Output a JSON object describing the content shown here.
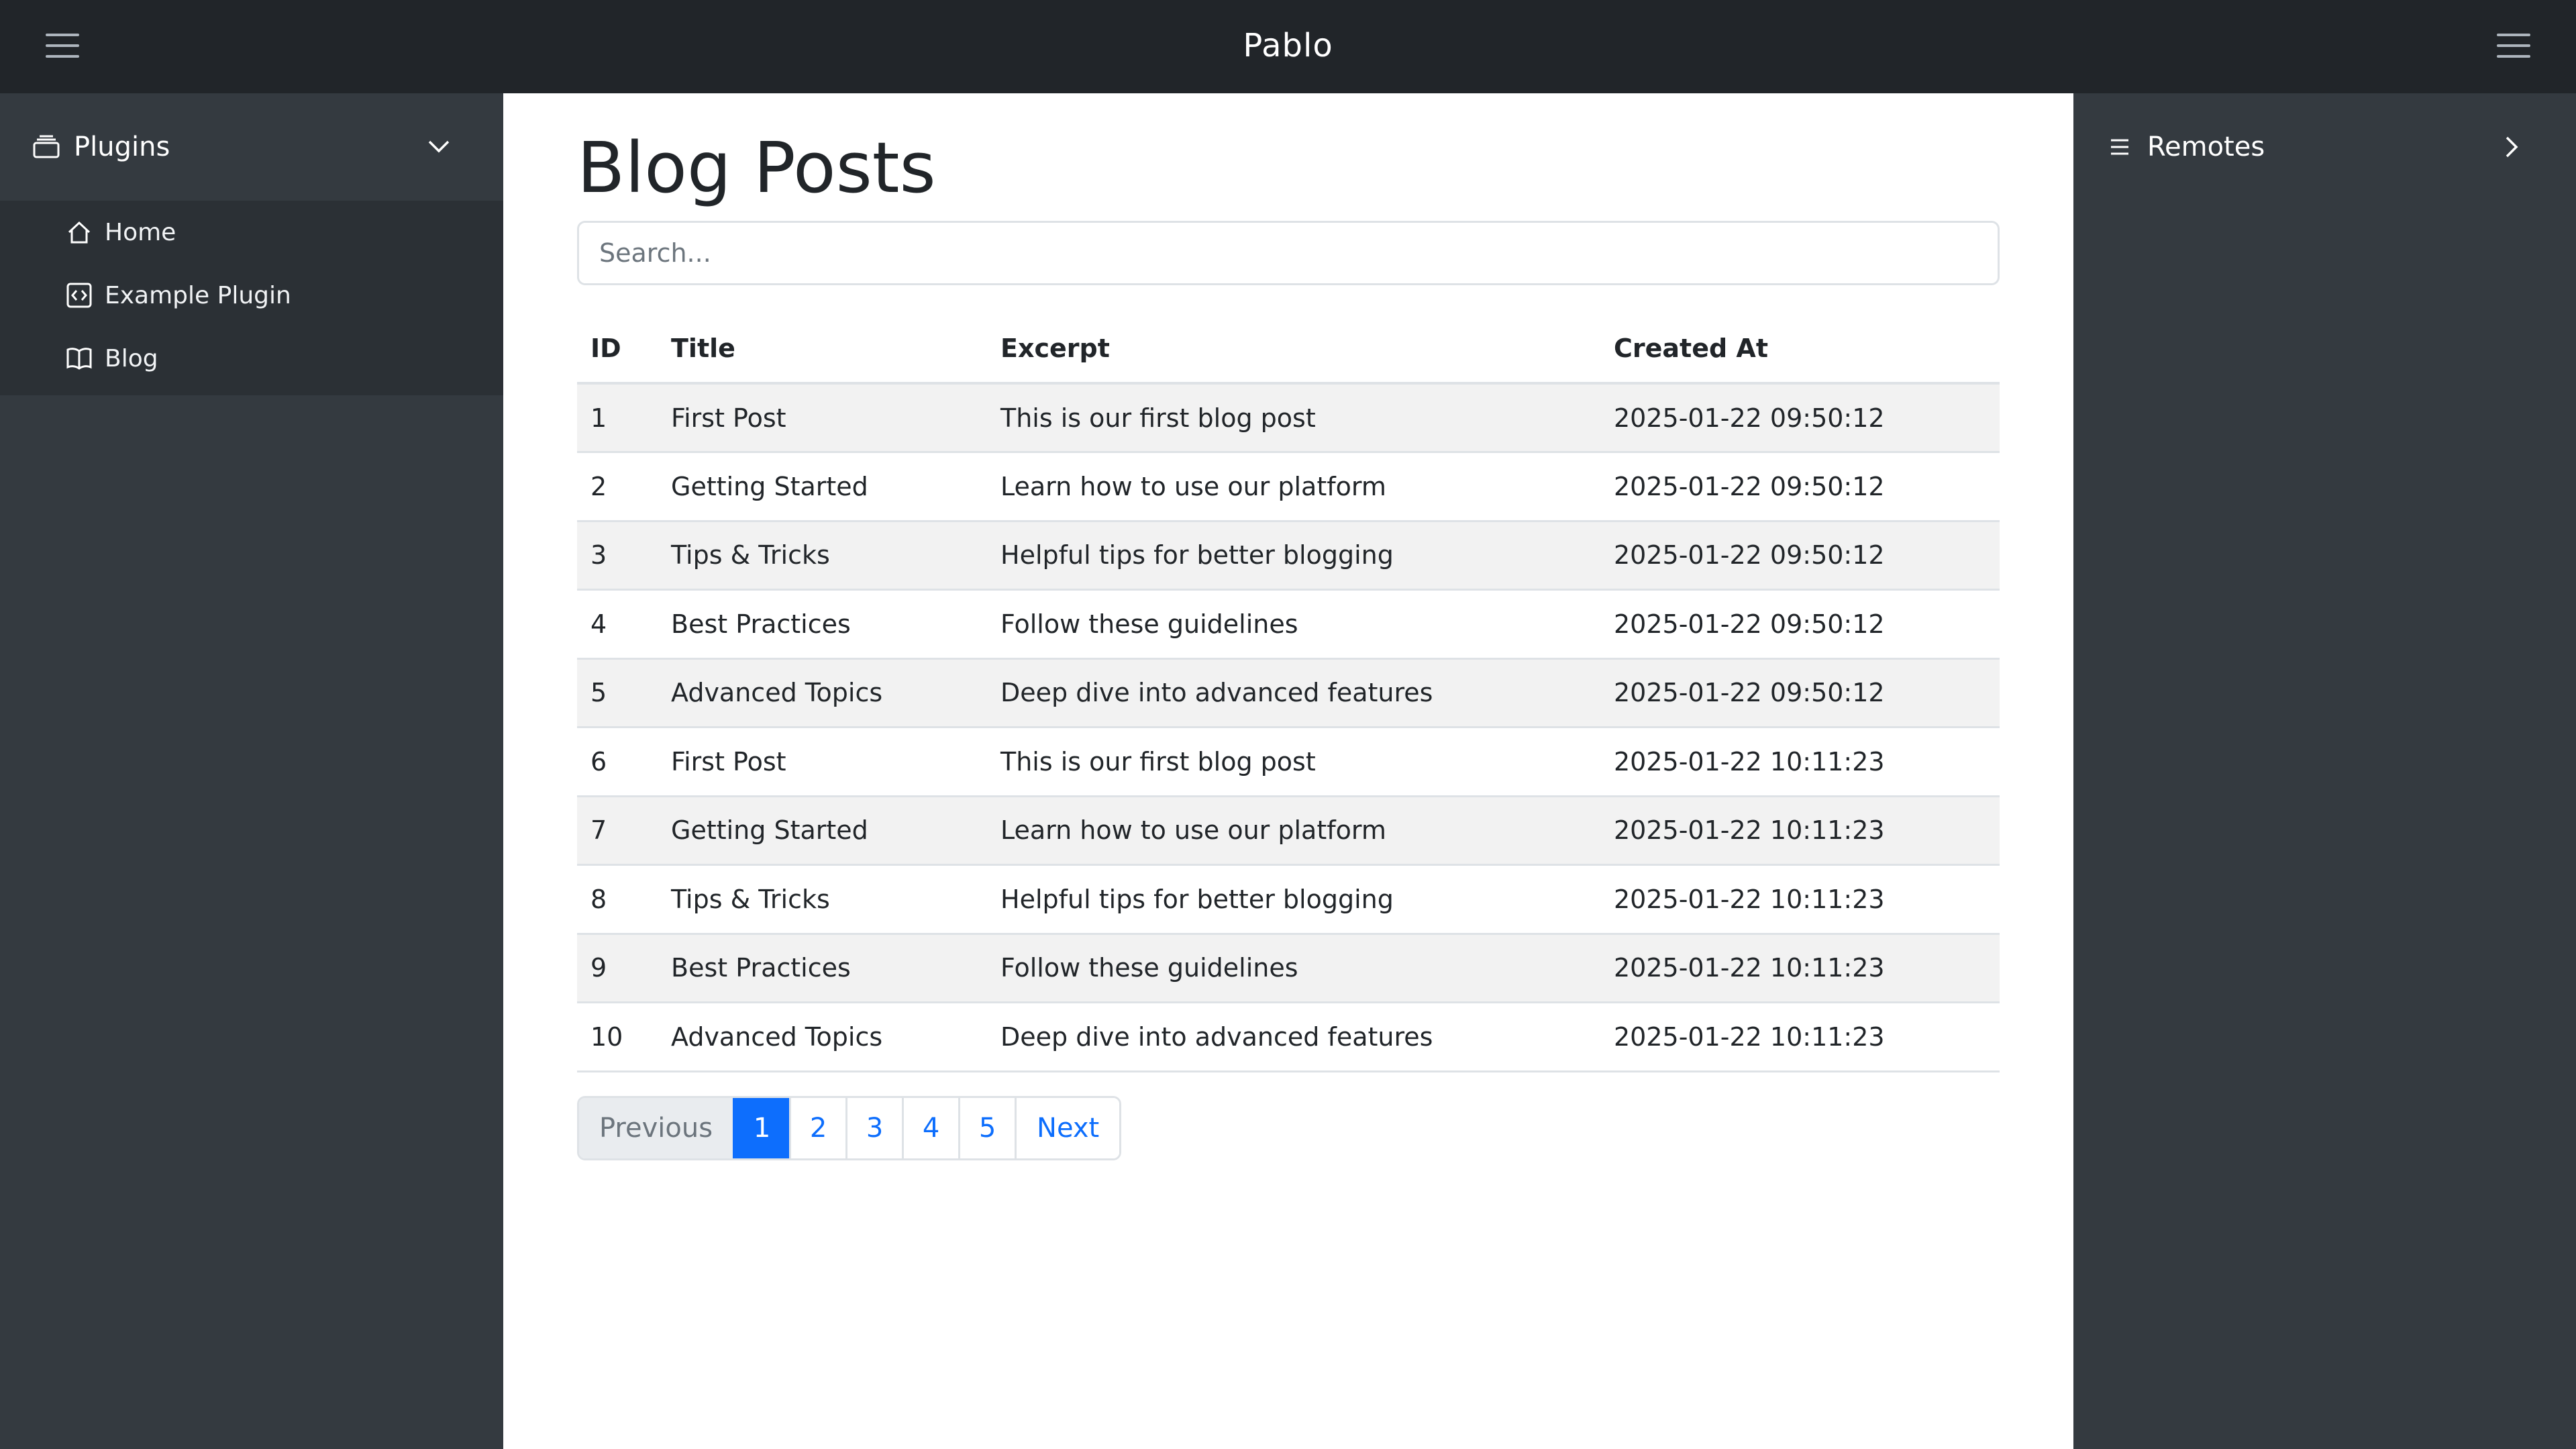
{
  "app": {
    "title": "Pablo"
  },
  "sidebar": {
    "section_label": "Plugins",
    "items": [
      {
        "label": "Home",
        "icon": "home-icon"
      },
      {
        "label": "Example Plugin",
        "icon": "code-icon"
      },
      {
        "label": "Blog",
        "icon": "book-icon"
      }
    ]
  },
  "main": {
    "title": "Blog Posts",
    "search_placeholder": "Search...",
    "table": {
      "headers": [
        "ID",
        "Title",
        "Excerpt",
        "Created At"
      ],
      "rows": [
        [
          "1",
          "First Post",
          "This is our first blog post",
          "2025-01-22 09:50:12"
        ],
        [
          "2",
          "Getting Started",
          "Learn how to use our platform",
          "2025-01-22 09:50:12"
        ],
        [
          "3",
          "Tips & Tricks",
          "Helpful tips for better blogging",
          "2025-01-22 09:50:12"
        ],
        [
          "4",
          "Best Practices",
          "Follow these guidelines",
          "2025-01-22 09:50:12"
        ],
        [
          "5",
          "Advanced Topics",
          "Deep dive into advanced features",
          "2025-01-22 09:50:12"
        ],
        [
          "6",
          "First Post",
          "This is our first blog post",
          "2025-01-22 10:11:23"
        ],
        [
          "7",
          "Getting Started",
          "Learn how to use our platform",
          "2025-01-22 10:11:23"
        ],
        [
          "8",
          "Tips & Tricks",
          "Helpful tips for better blogging",
          "2025-01-22 10:11:23"
        ],
        [
          "9",
          "Best Practices",
          "Follow these guidelines",
          "2025-01-22 10:11:23"
        ],
        [
          "10",
          "Advanced Topics",
          "Deep dive into advanced features",
          "2025-01-22 10:11:23"
        ]
      ]
    },
    "pagination": {
      "previous": "Previous",
      "pages": [
        "1",
        "2",
        "3",
        "4",
        "5"
      ],
      "current": "1",
      "next": "Next"
    }
  },
  "right_panel": {
    "label": "Remotes"
  },
  "colors": {
    "topbar": "#212529",
    "sidebar": "#343a40",
    "accent": "#0d6efd"
  }
}
